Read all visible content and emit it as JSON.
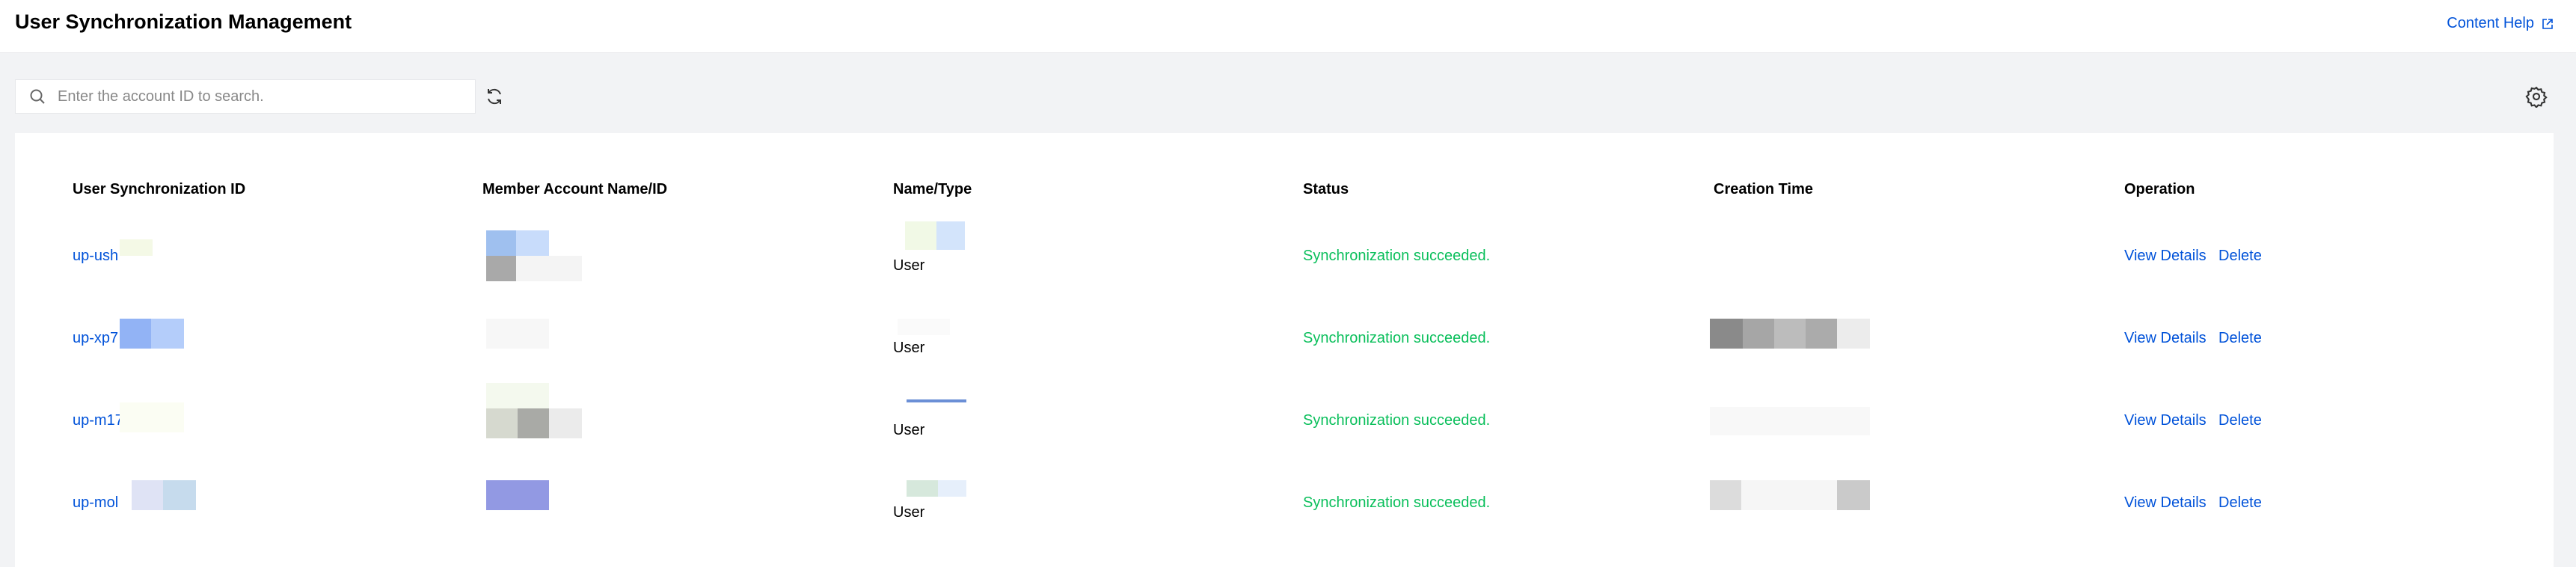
{
  "header": {
    "title": "User Synchronization Management",
    "help_label": "Content Help"
  },
  "toolbar": {
    "search_placeholder": "Enter the account ID to search."
  },
  "table": {
    "columns": [
      "User Synchronization ID",
      "Member Account Name/ID",
      "Name/Type",
      "Status",
      "Creation Time",
      "Operation"
    ],
    "rows": [
      {
        "id": "up-ush",
        "type": "User",
        "status": "Synchronization succeeded.",
        "view": "View Details",
        "delete": "Delete"
      },
      {
        "id": "up-xp7",
        "type": "User",
        "status": "Synchronization succeeded.",
        "view": "View Details",
        "delete": "Delete"
      },
      {
        "id": "up-m17",
        "type": "User",
        "status": "Synchronization succeeded.",
        "view": "View Details",
        "delete": "Delete"
      },
      {
        "id": "up-mol",
        "type": "User",
        "status": "Synchronization succeeded.",
        "view": "View Details",
        "delete": "Delete"
      }
    ]
  },
  "colors": {
    "link": "#0052d9",
    "success": "#0abf5b",
    "background": "#f2f3f5"
  }
}
